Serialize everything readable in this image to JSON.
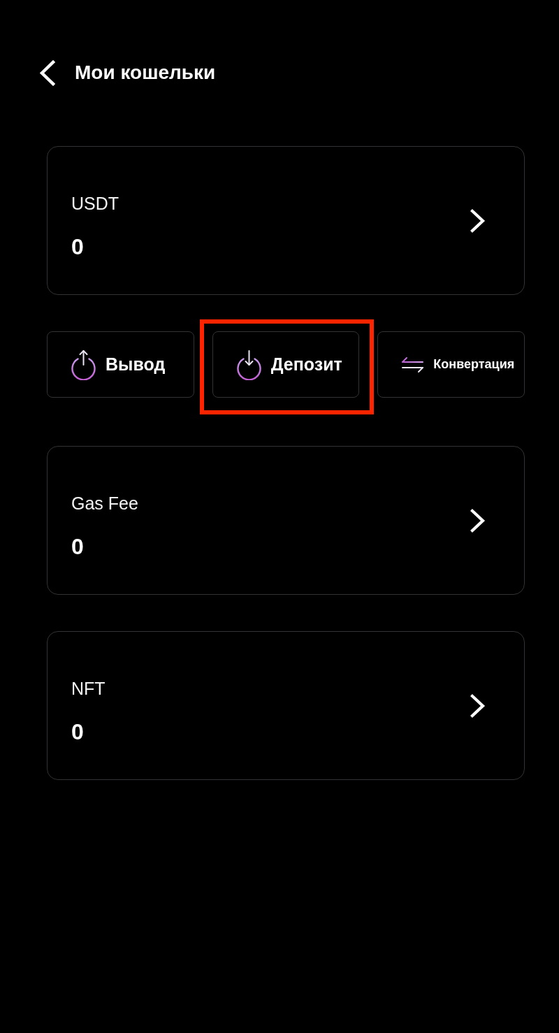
{
  "header": {
    "title": "Мои кошельки"
  },
  "main_wallet": {
    "name": "USDT",
    "balance": "0"
  },
  "actions": [
    {
      "kind": "withdraw",
      "label": "Вывод",
      "highlighted": false
    },
    {
      "kind": "deposit",
      "label": "Депозит",
      "highlighted": true
    },
    {
      "kind": "convert",
      "label": "Конвертация",
      "highlighted": false
    }
  ],
  "wallets": [
    {
      "name": "Gas Fee",
      "balance": "0"
    },
    {
      "name": "NFT",
      "balance": "0"
    }
  ]
}
